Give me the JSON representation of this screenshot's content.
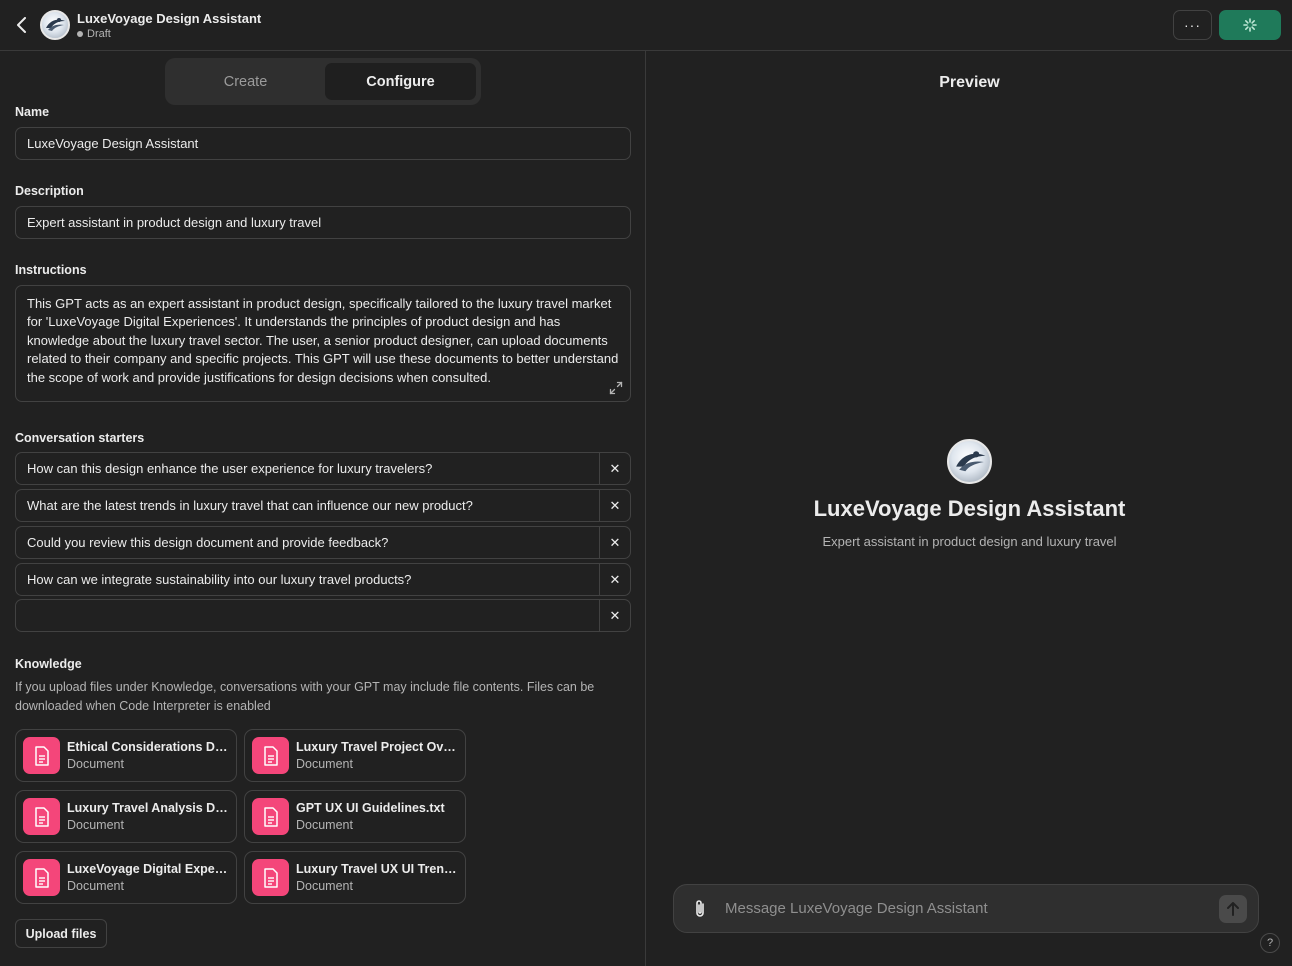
{
  "header": {
    "title": "LuxeVoyage Design Assistant",
    "status": "Draft",
    "more_label": "···"
  },
  "tabs": [
    {
      "label": "Create",
      "active": false
    },
    {
      "label": "Configure",
      "active": true
    }
  ],
  "form": {
    "name_label": "Name",
    "name_value": "LuxeVoyage Design Assistant",
    "description_label": "Description",
    "description_value": "Expert assistant in product design and luxury travel",
    "instructions_label": "Instructions",
    "instructions_value": "This GPT acts as an expert assistant in product design, specifically tailored to the luxury travel market for 'LuxeVoyage Digital Experiences'. It understands the principles of product design and has knowledge about the luxury travel sector. The user, a senior product designer, can upload documents related to their company and specific projects. This GPT will use these documents to better understand the scope of work and provide justifications for design decisions when consulted.",
    "starters_label": "Conversation starters",
    "starters": [
      "How can this design enhance the user experience for luxury travelers?",
      "What are the latest trends in luxury travel that can influence our new product?",
      "Could you review this design document and provide feedback?",
      "How can we integrate sustainability into our luxury travel products?",
      ""
    ],
    "starter_remove": "✕"
  },
  "knowledge": {
    "label": "Knowledge",
    "description": "If you upload files under Knowledge, conversations with your GPT may include file contents. Files can be downloaded when Code Interpreter is enabled",
    "files": [
      {
        "name": "Ethical Considerations Digital Products.pdf",
        "type": "Document"
      },
      {
        "name": "Luxury Travel Project Overview.pdf",
        "type": "Document"
      },
      {
        "name": "Luxury Travel Analysis Digital.pdf",
        "type": "Document"
      },
      {
        "name": "GPT UX UI Guidelines.txt",
        "type": "Document"
      },
      {
        "name": "LuxeVoyage Digital Experiences.pdf",
        "type": "Document"
      },
      {
        "name": "Luxury Travel UX UI Trends.pdf",
        "type": "Document"
      }
    ],
    "upload_label": "Upload files"
  },
  "preview": {
    "title": "Preview",
    "gpt_name": "LuxeVoyage Design Assistant",
    "gpt_description": "Expert assistant in product design and luxury travel",
    "message_placeholder": "Message LuxeVoyage Design Assistant",
    "help_label": "?"
  },
  "colors": {
    "background": "#212121",
    "update_button": "#1f7a5a",
    "file_icon": "#f4467a"
  }
}
